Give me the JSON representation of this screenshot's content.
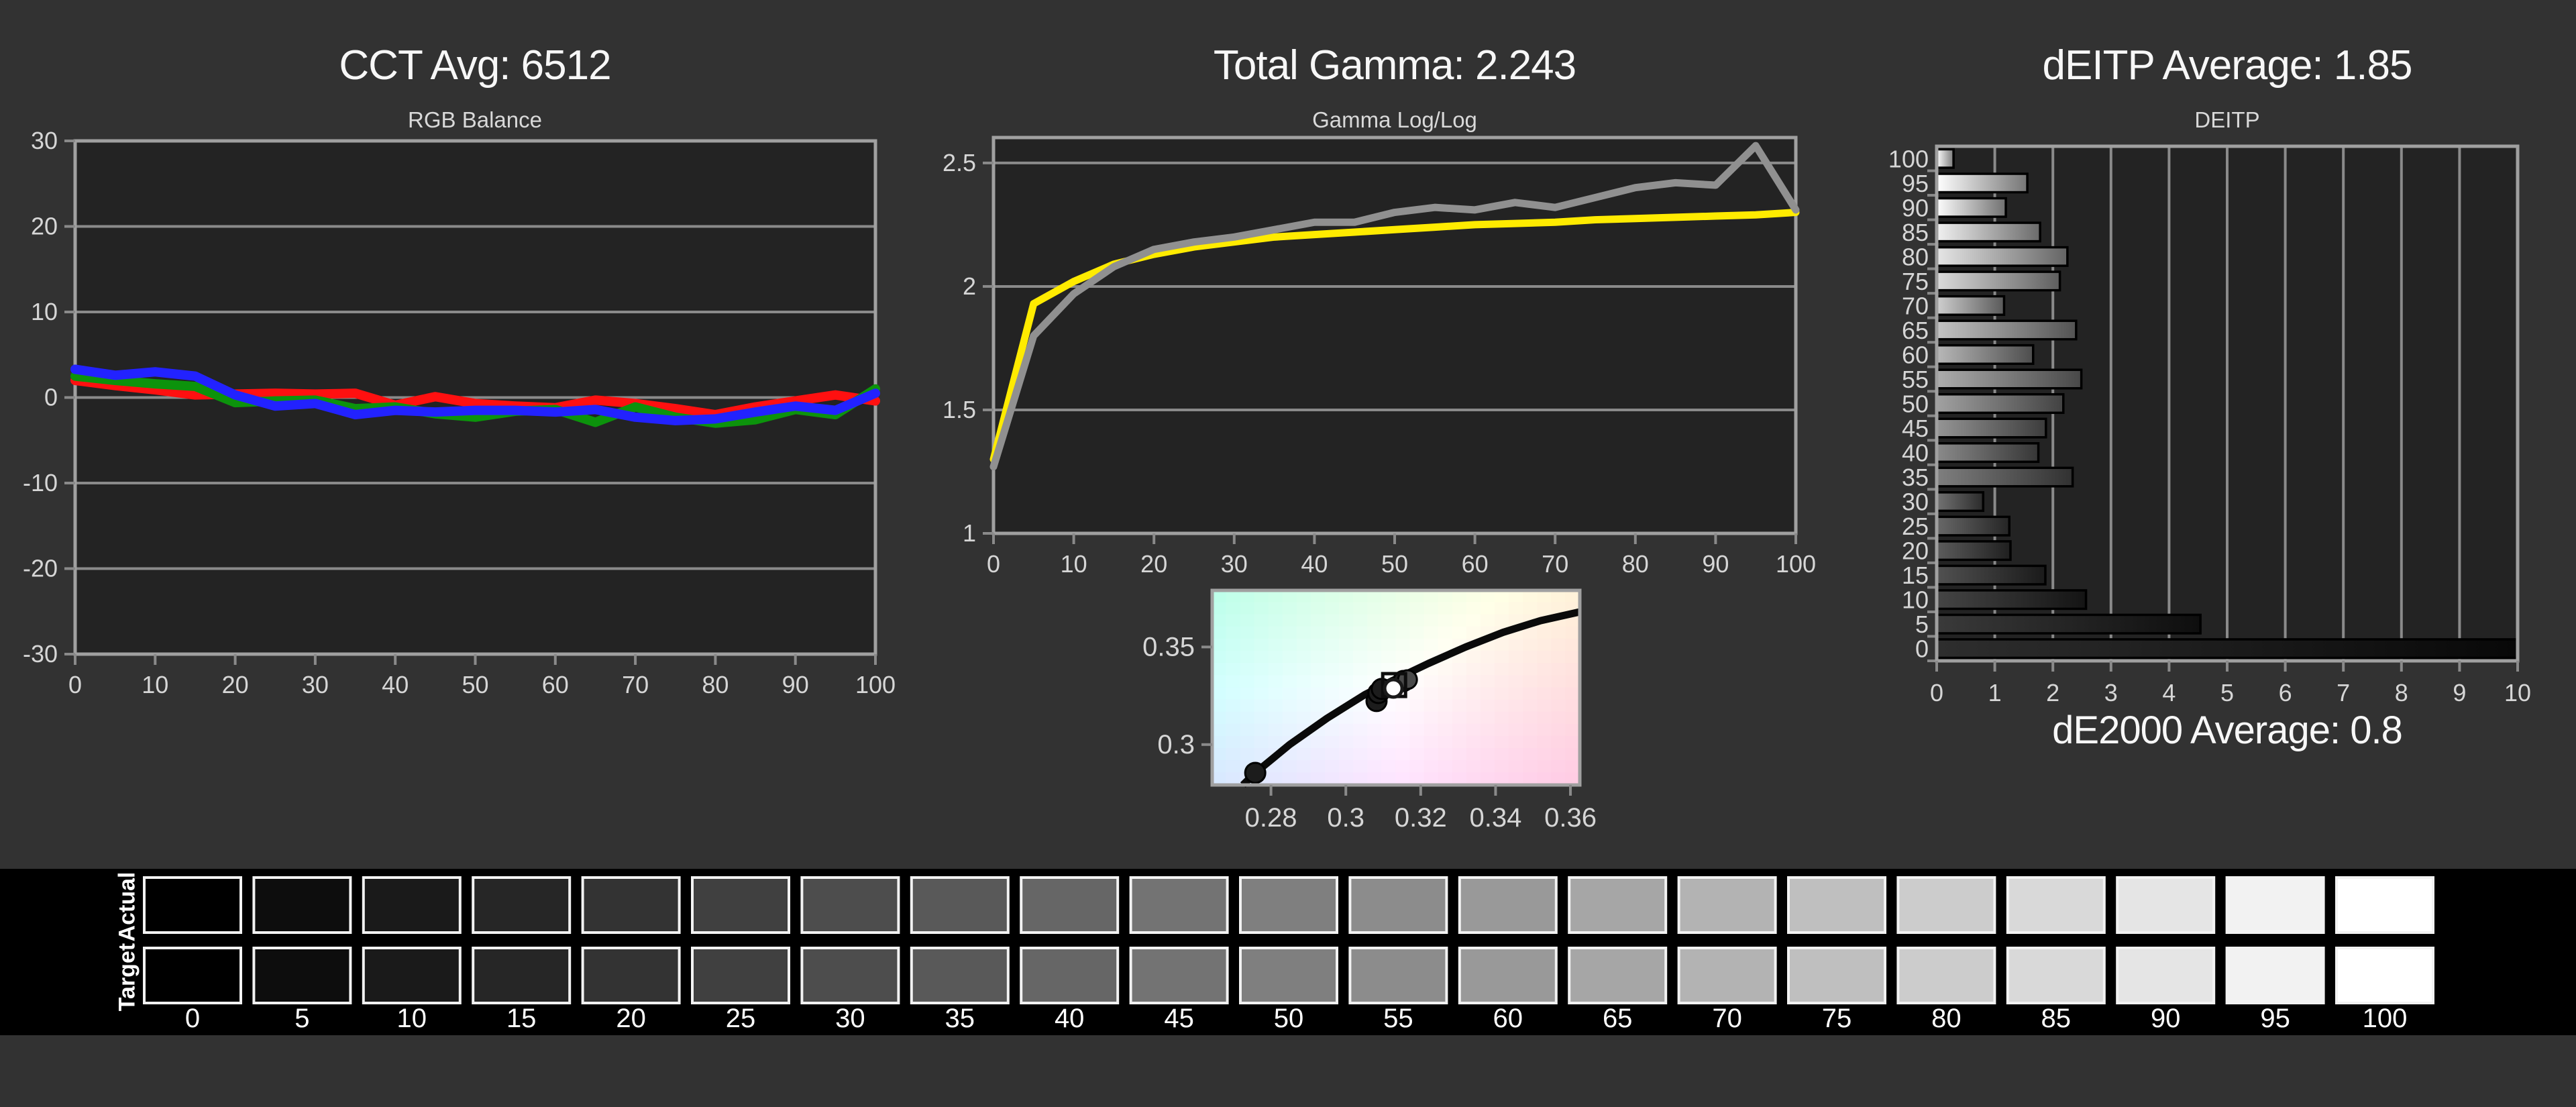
{
  "colors": {
    "page_bg": "#323232",
    "plot_bg": "#232323",
    "grid": "#8a8a8a",
    "plot_border": "#a0a0a0",
    "axis_text": "#d6d6d6",
    "title_text": "#f7f7f7",
    "red": "#ff1010",
    "green": "#0c930c",
    "blue": "#2222ff",
    "reference_yellow": "#ffeb00",
    "measured_gray": "#909090",
    "bar_border": "#000000",
    "strip_bg": "#000000",
    "swatch_border": "#f2f2f2",
    "locus_black": "#0a0a0a"
  },
  "chart_data": [
    {
      "type": "line",
      "title": "CCT Avg: 6512",
      "subtitle": "RGB Balance",
      "x": [
        0,
        5,
        10,
        15,
        20,
        25,
        30,
        35,
        40,
        45,
        50,
        55,
        60,
        65,
        70,
        75,
        80,
        85,
        90,
        95,
        100
      ],
      "xticks": [
        0,
        10,
        20,
        30,
        40,
        50,
        60,
        70,
        80,
        90,
        100
      ],
      "yticks": [
        30,
        20,
        10,
        0,
        -10,
        -20,
        -30
      ],
      "ylim": [
        -30,
        30
      ],
      "grid": "horizontal",
      "legend": "none",
      "series": [
        {
          "name": "Red",
          "color": "#ff1010",
          "values": [
            2.0,
            1.4,
            0.9,
            0.3,
            0.4,
            0.5,
            0.4,
            0.5,
            -0.9,
            0.1,
            -0.7,
            -1.0,
            -1.2,
            -0.3,
            -0.7,
            -1.3,
            -2.0,
            -1.1,
            -0.4,
            0.3,
            -0.4
          ]
        },
        {
          "name": "Green",
          "color": "#0c930c",
          "values": [
            2.5,
            2.0,
            1.6,
            1.3,
            -0.6,
            -0.4,
            -0.3,
            -1.3,
            -1.1,
            -1.9,
            -2.3,
            -1.6,
            -1.4,
            -2.9,
            -1.1,
            -2.3,
            -3.0,
            -2.6,
            -1.4,
            -2.0,
            1.0
          ]
        },
        {
          "name": "Blue",
          "color": "#2222ff",
          "values": [
            3.3,
            2.6,
            3.0,
            2.5,
            0.3,
            -1.0,
            -0.7,
            -2.0,
            -1.5,
            -1.7,
            -1.5,
            -1.5,
            -1.7,
            -1.4,
            -2.3,
            -2.7,
            -2.5,
            -1.7,
            -1.0,
            -1.5,
            0.5
          ]
        }
      ]
    },
    {
      "type": "line",
      "title": "Total Gamma: 2.243",
      "subtitle": "Gamma Log/Log",
      "x": [
        0,
        5,
        10,
        15,
        20,
        25,
        30,
        35,
        40,
        45,
        50,
        55,
        60,
        65,
        70,
        75,
        80,
        85,
        90,
        95,
        100
      ],
      "xticks": [
        0,
        10,
        20,
        30,
        40,
        50,
        60,
        70,
        80,
        90,
        100
      ],
      "yticks": [
        2.5,
        2,
        1.5,
        1
      ],
      "ylim": [
        1,
        2.603
      ],
      "grid": "horizontal",
      "legend": "none",
      "series": [
        {
          "name": "Reference",
          "color": "#ffeb00",
          "values": [
            1.3,
            1.93,
            2.02,
            2.09,
            2.13,
            2.16,
            2.18,
            2.2,
            2.21,
            2.22,
            2.23,
            2.24,
            2.25,
            2.255,
            2.26,
            2.27,
            2.275,
            2.28,
            2.285,
            2.29,
            2.3
          ]
        },
        {
          "name": "Measured",
          "color": "#909090",
          "values": [
            1.27,
            1.8,
            1.97,
            2.08,
            2.15,
            2.18,
            2.2,
            2.23,
            2.26,
            2.26,
            2.3,
            2.32,
            2.31,
            2.34,
            2.32,
            2.36,
            2.4,
            2.42,
            2.41,
            2.57,
            2.31
          ]
        }
      ]
    },
    {
      "type": "scatter",
      "title": "",
      "subtitle": "",
      "name": "white-point-cie",
      "xlim": [
        0.2643,
        0.3625
      ],
      "ylim": [
        0.2793,
        0.379
      ],
      "xticks": [
        "0.28",
        "0.3",
        "0.32",
        "0.34",
        "0.36"
      ],
      "xtick_values": [
        0.28,
        0.3,
        0.32,
        0.34,
        0.36
      ],
      "yticks": [
        "0.35",
        "0.3"
      ],
      "ytick_values": [
        0.35,
        0.3
      ],
      "locus": [
        [
          0.2725,
          0.2793
        ],
        [
          0.2758,
          0.2855
        ],
        [
          0.285,
          0.3
        ],
        [
          0.295,
          0.3135
        ],
        [
          0.305,
          0.3255
        ],
        [
          0.3127,
          0.333
        ],
        [
          0.322,
          0.3415
        ],
        [
          0.332,
          0.35
        ],
        [
          0.342,
          0.3575
        ],
        [
          0.352,
          0.3635
        ],
        [
          0.3625,
          0.368
        ]
      ],
      "points": [
        [
          0.2758,
          0.2855
        ],
        [
          0.3082,
          0.3223
        ],
        [
          0.3087,
          0.3264
        ],
        [
          0.3096,
          0.3285
        ],
        [
          0.3154,
          0.3326
        ]
      ],
      "target_square": [
        0.3129,
        0.3305
      ],
      "white_circle": [
        0.3127,
        0.3288
      ]
    },
    {
      "type": "bar",
      "orientation": "horizontal",
      "title": "dEITP Average: 1.85",
      "subtitle": "DEITP",
      "footer_label": "dE2000 Average: 0.8",
      "categories": [
        100,
        95,
        90,
        85,
        80,
        75,
        70,
        65,
        60,
        55,
        50,
        45,
        40,
        35,
        30,
        25,
        20,
        15,
        10,
        5,
        0
      ],
      "values": [
        0.29,
        1.56,
        1.19,
        1.78,
        2.25,
        2.12,
        1.16,
        2.4,
        1.66,
        2.49,
        2.18,
        1.88,
        1.75,
        2.34,
        0.8,
        1.25,
        1.27,
        1.87,
        2.57,
        4.54,
        10.0
      ],
      "xlim": [
        0,
        10
      ],
      "xticks": [
        0,
        1,
        2,
        3,
        4,
        5,
        6,
        7,
        8,
        9,
        10
      ],
      "grid": "vertical"
    },
    {
      "type": "table",
      "name": "grayscale-ramp",
      "row_labels": [
        "Actual",
        "Target"
      ],
      "categories": [
        0,
        5,
        10,
        15,
        20,
        25,
        30,
        35,
        40,
        45,
        50,
        55,
        60,
        65,
        70,
        75,
        80,
        85,
        90,
        95,
        100
      ]
    }
  ]
}
